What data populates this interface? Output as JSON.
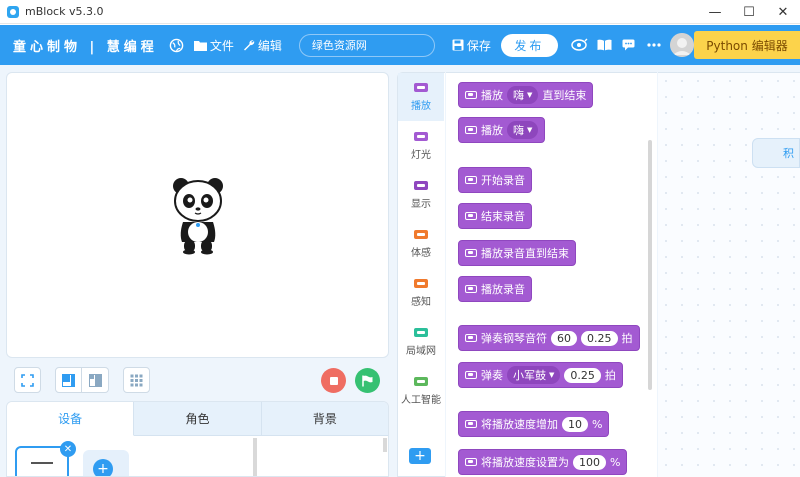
{
  "window": {
    "title": "mBlock v5.3.0",
    "controls": {
      "minimize": "—",
      "maximize": "☐",
      "close": "✕"
    }
  },
  "menubar": {
    "brand": "童心制物 | 慧编程",
    "file_label": "文件",
    "edit_label": "编辑",
    "project_name": "绿色资源网",
    "save_label": "保存",
    "publish_label": "发布",
    "python_label": "Python 编辑器"
  },
  "stage": {
    "stop_label": "stop",
    "go_label": "go"
  },
  "tabs": [
    {
      "label": "设备",
      "active": true
    },
    {
      "label": "角色",
      "active": false
    },
    {
      "label": "背景",
      "active": false
    }
  ],
  "categories": [
    {
      "label": "播放",
      "color": "#a35ad2",
      "active": true
    },
    {
      "label": "灯光",
      "color": "#a35ad2",
      "active": false
    },
    {
      "label": "显示",
      "color": "#8f47bf",
      "active": false
    },
    {
      "label": "体感",
      "color": "#f07a2d",
      "active": false
    },
    {
      "label": "感知",
      "color": "#f07a2d",
      "active": false
    },
    {
      "label": "局域网",
      "color": "#2bbf9a",
      "active": false
    },
    {
      "label": "人工智能",
      "color": "#5cb85c",
      "active": false
    }
  ],
  "blocks": [
    {
      "text": "播放",
      "dropdown": "嗨",
      "after": "直到结束"
    },
    {
      "text": "播放",
      "dropdown": "嗨",
      "after": ""
    },
    {
      "text": "开始录音"
    },
    {
      "text": "结束录音"
    },
    {
      "text": "播放录音直到结束"
    },
    {
      "text": "播放录音"
    },
    {
      "text": "弹奏钢琴音符",
      "num1": "60",
      "num2": "0.25",
      "after": "拍"
    },
    {
      "text": "弹奏",
      "dropdown": "小军鼓",
      "num1": "0.25",
      "after": "拍"
    },
    {
      "text": "将播放速度增加",
      "num1": "10",
      "after": "%"
    },
    {
      "text": "将播放速度设置为",
      "num1": "100",
      "after": "%"
    }
  ],
  "script_area": {
    "sprite_tab": "积"
  },
  "colors": {
    "brand_blue": "#2f9cf1",
    "block_purple": "#a35ad2",
    "python_yellow": "#fcd34b"
  }
}
